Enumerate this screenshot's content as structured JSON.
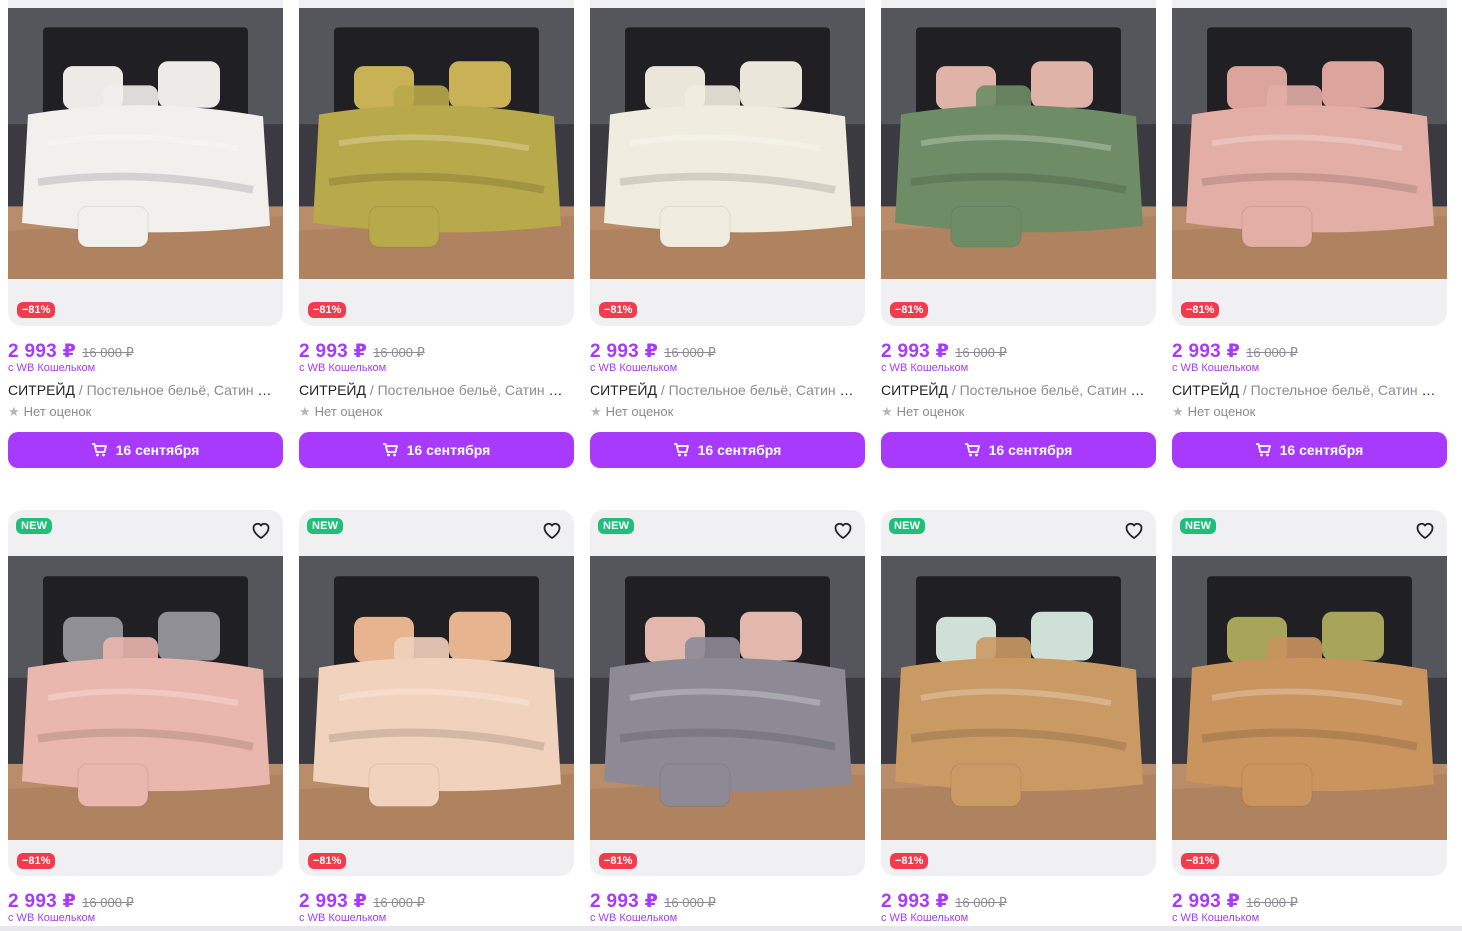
{
  "colors": {
    "accent": "#a73afd",
    "discount": "#f23c4d",
    "new_badge": "#1fbf7a",
    "muted": "#8b8b95",
    "card_bg": "#f0f0f3"
  },
  "icons": {
    "cart": "cart-icon",
    "heart": "heart-icon",
    "star": "star-icon"
  },
  "row1": [
    {
      "discount": "−81%",
      "price": "2 993 ₽",
      "old_price": "16 000 ₽",
      "wallet": "с WB Кошельком",
      "brand": "СИТРЕЙД",
      "name": " / Постельное бельё, Сатин Жаккард",
      "rating": "Нет оценок",
      "delivery": "16 сентября",
      "bedding": "#f2f0ed",
      "pillow": "#ecebe8"
    },
    {
      "discount": "−81%",
      "price": "2 993 ₽",
      "old_price": "16 000 ₽",
      "wallet": "с WB Кошельком",
      "brand": "СИТРЕЙД",
      "name": " / Постельное бельё, Сатин Жаккард",
      "rating": "Нет оценок",
      "delivery": "16 сентября",
      "bedding": "#b8a94a",
      "pillow": "#c9b256"
    },
    {
      "discount": "−81%",
      "price": "2 993 ₽",
      "old_price": "16 000 ₽",
      "wallet": "с WB Кошельком",
      "brand": "СИТРЕЙД",
      "name": " / Постельное бельё, Сатин Жаккард",
      "rating": "Нет оценок",
      "delivery": "16 сентября",
      "bedding": "#f1ece0",
      "pillow": "#ebe6da"
    },
    {
      "discount": "−81%",
      "price": "2 993 ₽",
      "old_price": "16 000 ₽",
      "wallet": "с WB Кошельком",
      "brand": "СИТРЕЙД",
      "name": " / Постельное бельё, Сатин Жаккард",
      "rating": "Нет оценок",
      "delivery": "16 сентября",
      "bedding": "#6e8c66",
      "pillow": "#e0b3a8"
    },
    {
      "discount": "−81%",
      "price": "2 993 ₽",
      "old_price": "16 000 ₽",
      "wallet": "с WB Кошельком",
      "brand": "СИТРЕЙД",
      "name": " / Постельное бельё, Сатин Жаккард",
      "rating": "Нет оценок",
      "delivery": "16 сентября",
      "bedding": "#e2aea6",
      "pillow": "#dba49c"
    }
  ],
  "row2": [
    {
      "new": "NEW",
      "discount": "−81%",
      "price": "2 993 ₽",
      "old_price": "16 000 ₽",
      "wallet": "с WB Кошельком",
      "bedding": "#eab7ae",
      "pillow": "#8f8f95"
    },
    {
      "new": "NEW",
      "discount": "−81%",
      "price": "2 993 ₽",
      "old_price": "16 000 ₽",
      "wallet": "с WB Кошельком",
      "bedding": "#f1d2bd",
      "pillow": "#e6b48e"
    },
    {
      "new": "NEW",
      "discount": "−81%",
      "price": "2 993 ₽",
      "old_price": "16 000 ₽",
      "wallet": "с WB Кошельком",
      "bedding": "#8d8a96",
      "pillow": "#e3b8ac"
    },
    {
      "new": "NEW",
      "discount": "−81%",
      "price": "2 993 ₽",
      "old_price": "16 000 ₽",
      "wallet": "с WB Кошельком",
      "bedding": "#c99a64",
      "pillow": "#cfe0d8"
    },
    {
      "new": "NEW",
      "discount": "−81%",
      "price": "2 993 ₽",
      "old_price": "16 000 ₽",
      "wallet": "с WB Кошельком",
      "bedding": "#c9945e",
      "pillow": "#a6a55a"
    }
  ]
}
